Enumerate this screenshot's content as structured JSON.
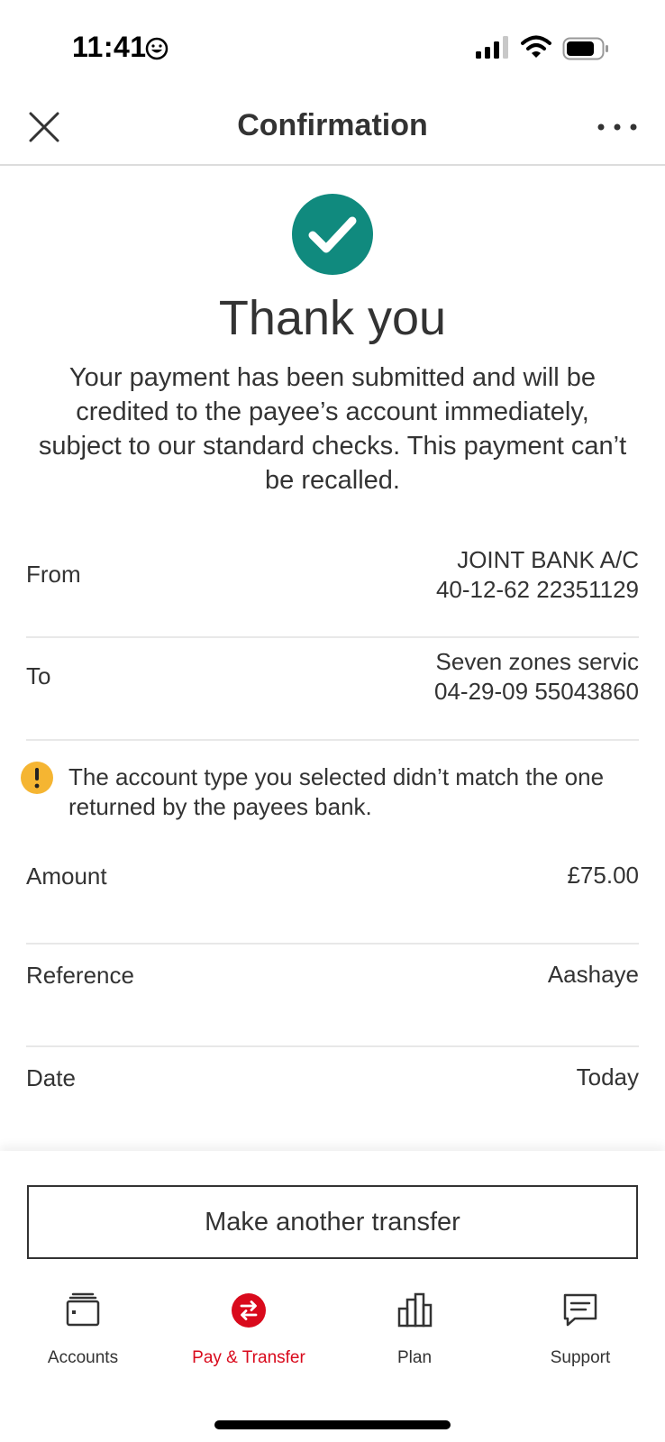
{
  "status_bar": {
    "time": "11:41"
  },
  "header": {
    "title": "Confirmation"
  },
  "success": {
    "title": "Thank you",
    "message": "Your payment has been submitted and will be credited to the payee’s account immediately, subject to our standard checks. This payment can’t be recalled."
  },
  "details": {
    "from": {
      "label": "From",
      "line1": "JOINT BANK A/C",
      "line2": "40-12-62 22351129"
    },
    "to": {
      "label": "To",
      "line1": "Seven zones servic",
      "line2": "04-29-09 55043860"
    },
    "warning": "The account type you selected didn’t match the one returned by the payees bank.",
    "amount": {
      "label": "Amount",
      "value": "£75.00"
    },
    "reference": {
      "label": "Reference",
      "value": "Aashaye"
    },
    "date": {
      "label": "Date",
      "value": "Today"
    }
  },
  "actions": {
    "make_another": "Make another transfer"
  },
  "tabs": [
    {
      "label": "Accounts",
      "icon": "wallet-icon",
      "active": false
    },
    {
      "label": "Pay & Transfer",
      "icon": "transfer-icon",
      "active": true
    },
    {
      "label": "Plan",
      "icon": "bar-chart-icon",
      "active": false
    },
    {
      "label": "Support",
      "icon": "chat-icon",
      "active": false
    }
  ],
  "colors": {
    "success": "#108a7e",
    "warning": "#f5b532",
    "active_tab": "#d90a1c",
    "text": "#333333"
  }
}
